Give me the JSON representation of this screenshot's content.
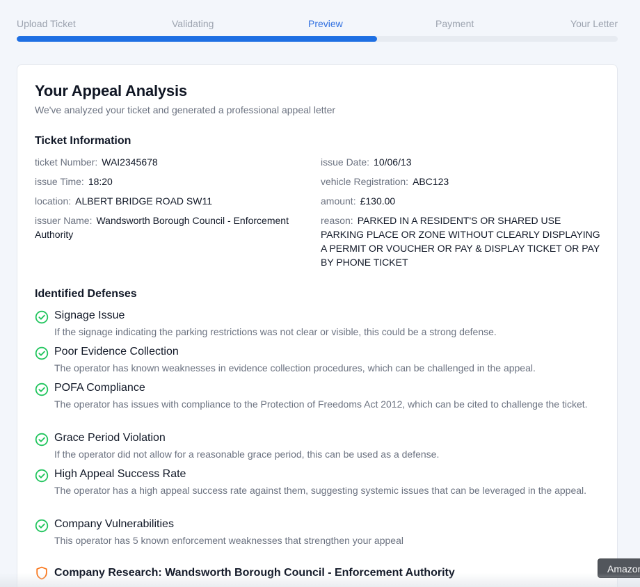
{
  "stepper": {
    "steps": [
      "Upload Ticket",
      "Validating",
      "Preview",
      "Payment",
      "Your Letter"
    ],
    "active_index": 2,
    "progress_fraction": 0.6
  },
  "card": {
    "title": "Your Appeal Analysis",
    "subtitle": "We've analyzed your ticket and generated a professional appeal letter"
  },
  "ticket": {
    "section_title": "Ticket Information",
    "ticket_number_label": "ticket Number:",
    "ticket_number": "WAI2345678",
    "issue_date_label": "issue Date:",
    "issue_date": "10/06/13",
    "issue_time_label": "issue Time:",
    "issue_time": "18:20",
    "vehicle_registration_label": "vehicle Registration:",
    "vehicle_registration": "ABC123",
    "location_label": "location:",
    "location": "ALBERT BRIDGE ROAD SW11",
    "amount_label": "amount:",
    "amount": "£130.00",
    "issuer_name_label": "issuer Name:",
    "issuer_name": "Wandsworth Borough Council - Enforcement Authority",
    "reason_label": "reason:",
    "reason": "PARKED IN A RESIDENT'S OR SHARED USE PARKING PLACE OR ZONE WITHOUT CLEARLY DISPLAYING A PERMIT OR VOUCHER OR PAY & DISPLAY TICKET OR PAY BY PHONE TICKET"
  },
  "defenses": {
    "section_title": "Identified Defenses",
    "items": [
      {
        "name": "Signage Issue",
        "description": "If the signage indicating the parking restrictions was not clear or visible, this could be a strong defense."
      },
      {
        "name": "Poor Evidence Collection",
        "description": "The operator has known weaknesses in evidence collection procedures, which can be challenged in the appeal."
      },
      {
        "name": "POFA Compliance",
        "description": "The operator has issues with compliance to the Protection of Freedoms Act 2012, which can be cited to challenge the ticket."
      },
      {
        "name": "Grace Period Violation",
        "description": "If the operator did not allow for a reasonable grace period, this can be used as a defense."
      },
      {
        "name": "High Appeal Success Rate",
        "description": "The operator has a high appeal success rate against them, suggesting systemic issues that can be leveraged in the appeal."
      },
      {
        "name": "Company Vulnerabilities",
        "description": "This operator has 5 known enforcement weaknesses that strengthen your appeal"
      }
    ]
  },
  "research": {
    "title": "Company Research: Wandsworth Borough Council - Enforcement Authority"
  },
  "tooltip": {
    "text": "Amazon"
  },
  "icons": {
    "defense_icon": "check-circle-icon",
    "research_icon": "shield-icon"
  },
  "colors": {
    "accent": "#1e6fe3",
    "active_step": "#2f6fe0",
    "check_green": "#22c55e",
    "shield_orange": "#f97316"
  }
}
